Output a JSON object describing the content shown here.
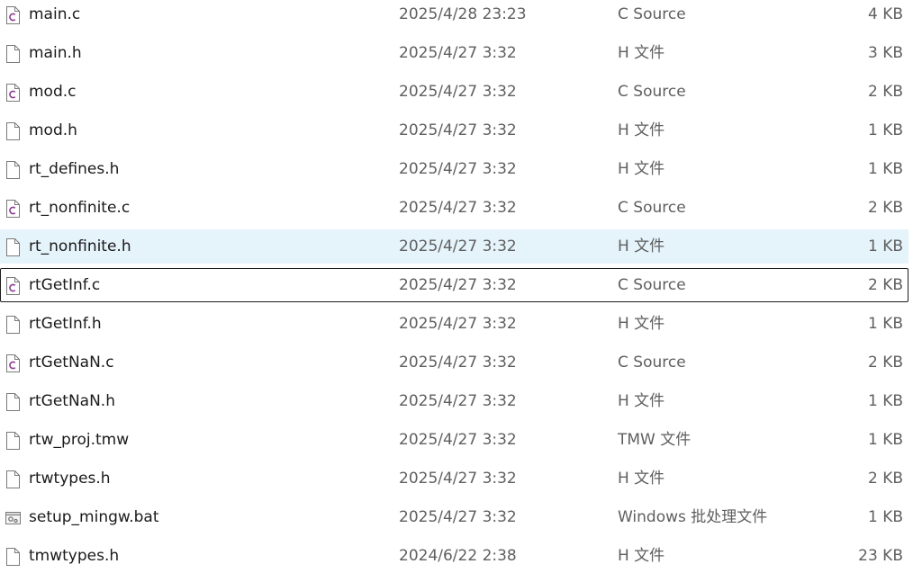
{
  "files": [
    {
      "name": "main.c",
      "date": "2025/4/28 23:23",
      "type": "C Source",
      "size": "4 KB",
      "icon": "c-source-file-icon",
      "state": "normal"
    },
    {
      "name": "main.h",
      "date": "2025/4/27 3:32",
      "type": "H 文件",
      "size": "3 KB",
      "icon": "header-file-icon",
      "state": "normal"
    },
    {
      "name": "mod.c",
      "date": "2025/4/27 3:32",
      "type": "C Source",
      "size": "2 KB",
      "icon": "c-source-file-icon",
      "state": "normal"
    },
    {
      "name": "mod.h",
      "date": "2025/4/27 3:32",
      "type": "H 文件",
      "size": "1 KB",
      "icon": "header-file-icon",
      "state": "normal"
    },
    {
      "name": "rt_defines.h",
      "date": "2025/4/27 3:32",
      "type": "H 文件",
      "size": "1 KB",
      "icon": "header-file-icon",
      "state": "normal"
    },
    {
      "name": "rt_nonfinite.c",
      "date": "2025/4/27 3:32",
      "type": "C Source",
      "size": "2 KB",
      "icon": "c-source-file-icon",
      "state": "normal"
    },
    {
      "name": "rt_nonfinite.h",
      "date": "2025/4/27 3:32",
      "type": "H 文件",
      "size": "1 KB",
      "icon": "header-file-icon",
      "state": "hover"
    },
    {
      "name": "rtGetInf.c",
      "date": "2025/4/27 3:32",
      "type": "C Source",
      "size": "2 KB",
      "icon": "c-source-file-icon",
      "state": "focused"
    },
    {
      "name": "rtGetInf.h",
      "date": "2025/4/27 3:32",
      "type": "H 文件",
      "size": "1 KB",
      "icon": "header-file-icon",
      "state": "normal"
    },
    {
      "name": "rtGetNaN.c",
      "date": "2025/4/27 3:32",
      "type": "C Source",
      "size": "2 KB",
      "icon": "c-source-file-icon",
      "state": "normal"
    },
    {
      "name": "rtGetNaN.h",
      "date": "2025/4/27 3:32",
      "type": "H 文件",
      "size": "1 KB",
      "icon": "header-file-icon",
      "state": "normal"
    },
    {
      "name": "rtw_proj.tmw",
      "date": "2025/4/27 3:32",
      "type": "TMW 文件",
      "size": "1 KB",
      "icon": "generic-file-icon",
      "state": "normal"
    },
    {
      "name": "rtwtypes.h",
      "date": "2025/4/27 3:32",
      "type": "H 文件",
      "size": "2 KB",
      "icon": "header-file-icon",
      "state": "normal"
    },
    {
      "name": "setup_mingw.bat",
      "date": "2025/4/27 3:32",
      "type": "Windows 批处理文件",
      "size": "1 KB",
      "icon": "batch-file-icon",
      "state": "normal"
    },
    {
      "name": "tmwtypes.h",
      "date": "2024/6/22 2:38",
      "type": "H 文件",
      "size": "23 KB",
      "icon": "header-file-icon",
      "state": "normal"
    }
  ]
}
